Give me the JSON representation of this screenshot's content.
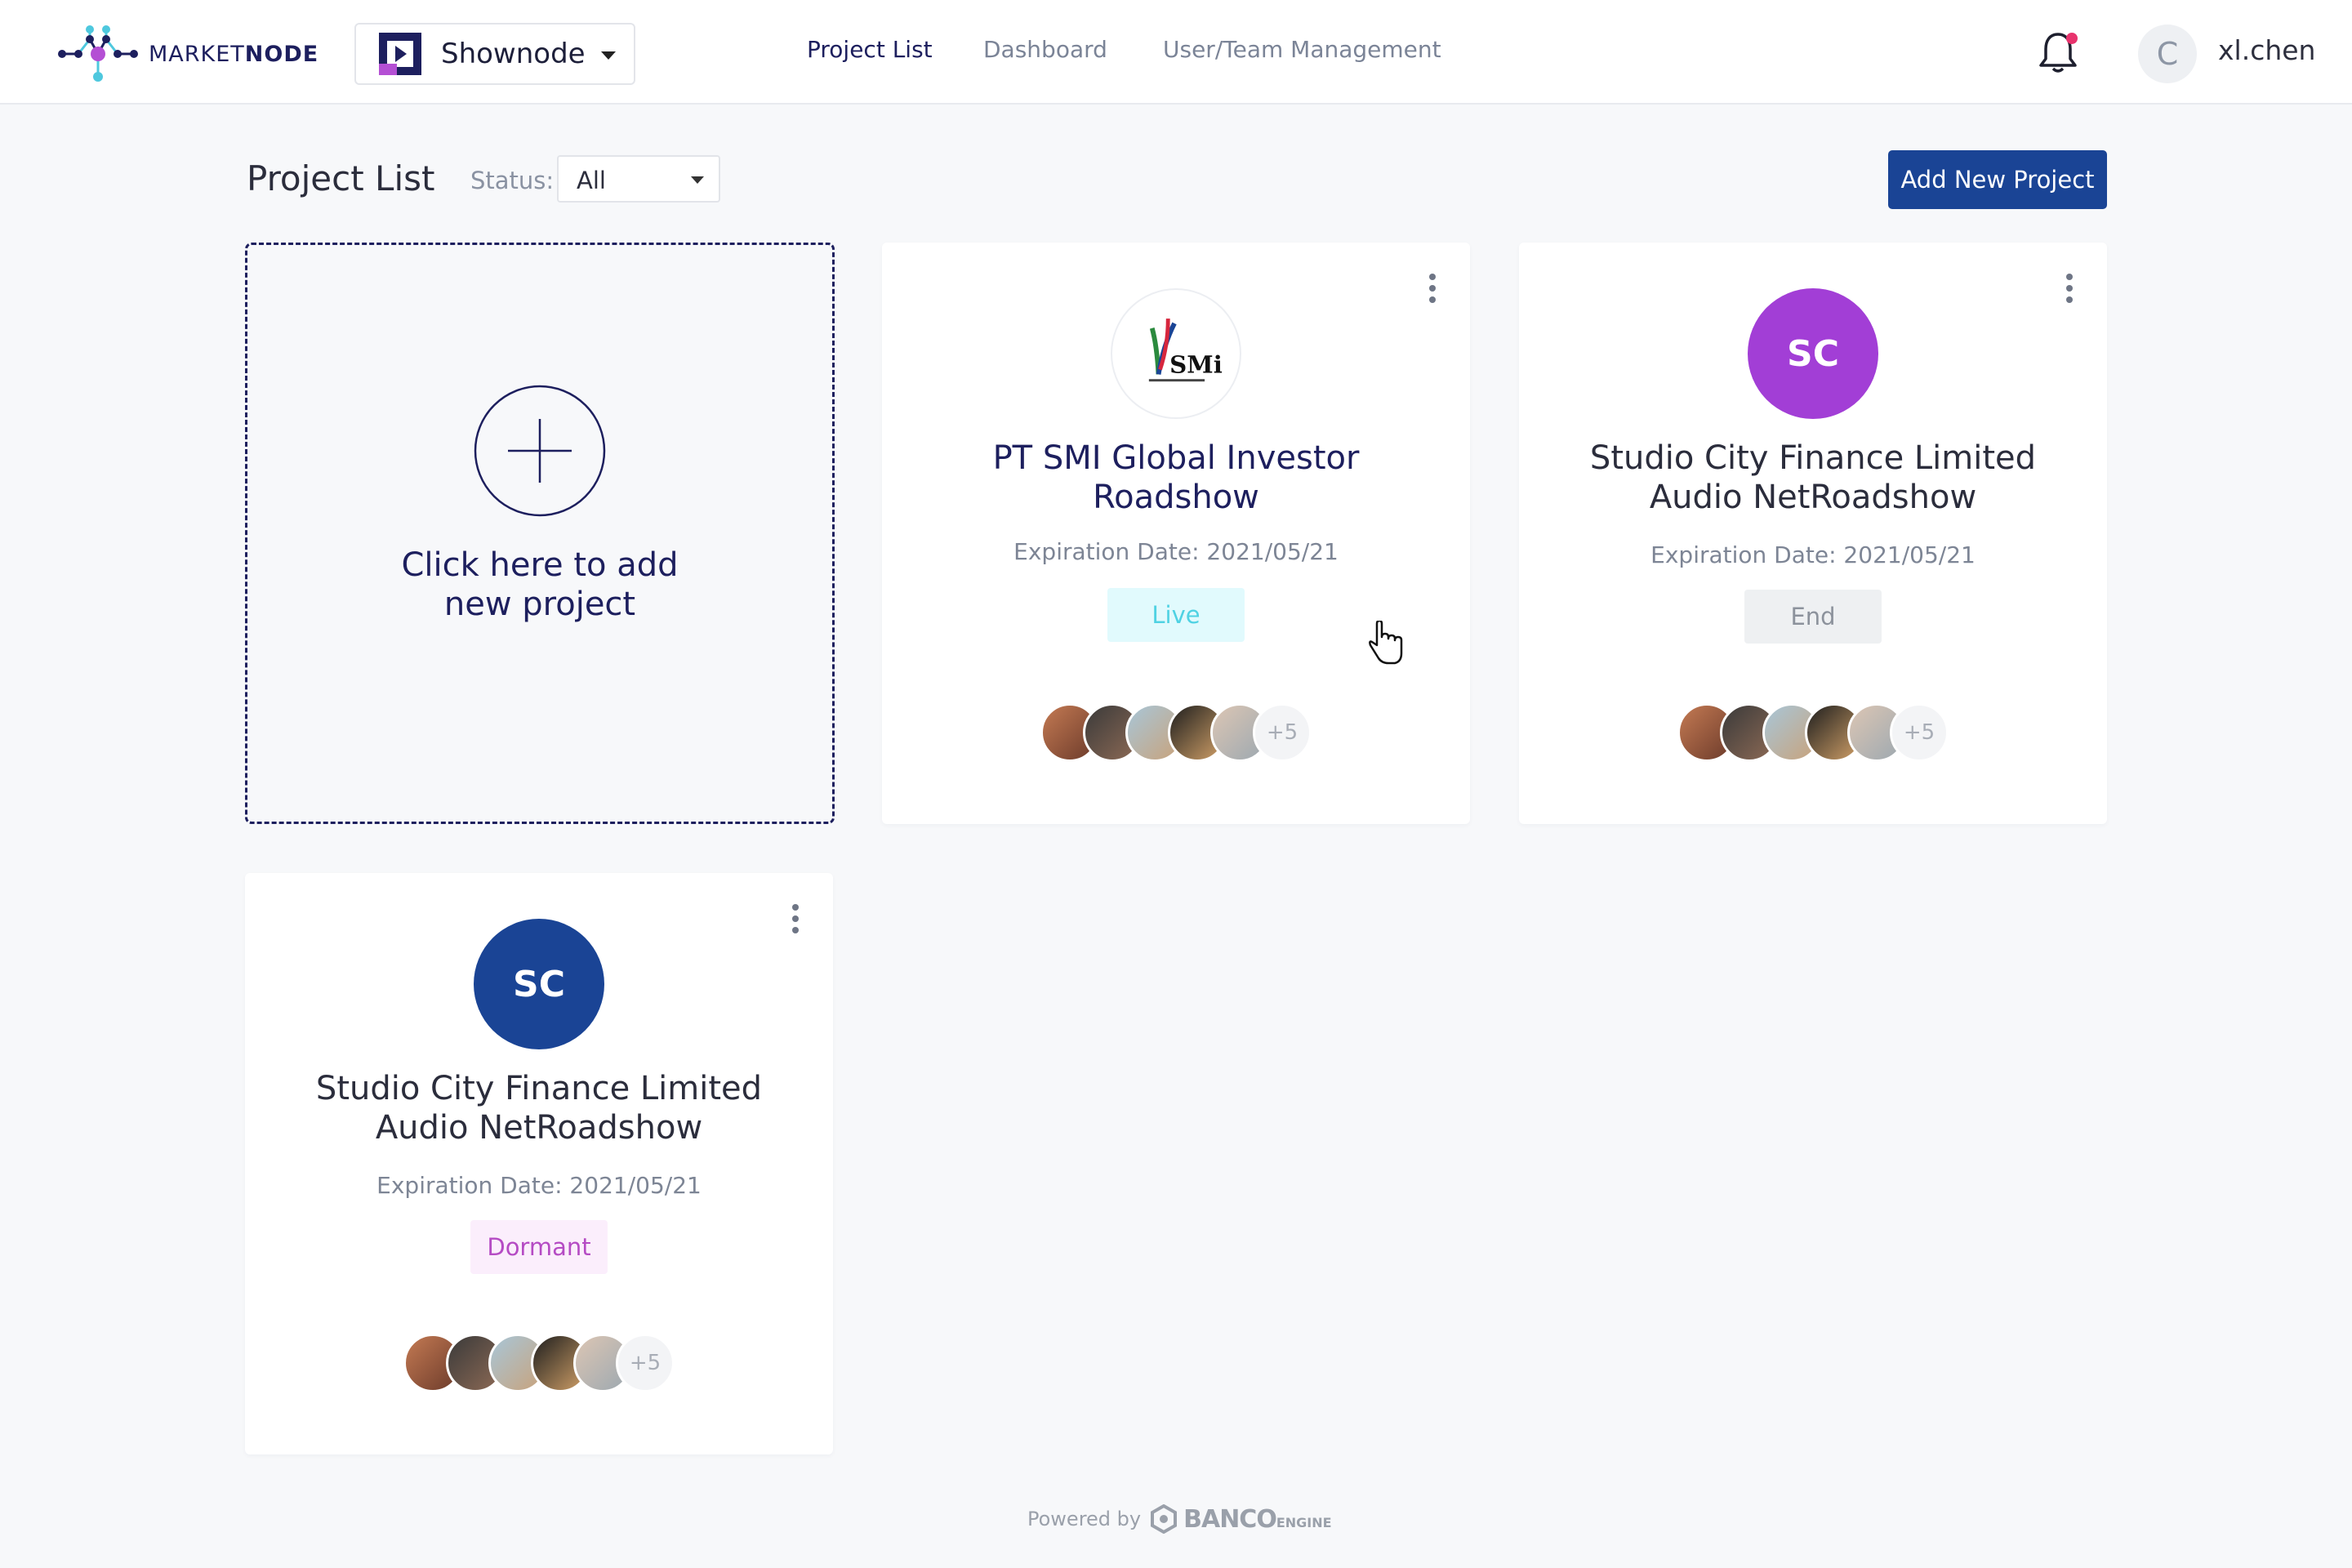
{
  "header": {
    "logo_text_1": "MARKET",
    "logo_text_2": "NODE",
    "app_switcher": {
      "name": "Shownode"
    },
    "nav": [
      {
        "label": "Project List",
        "active": true
      },
      {
        "label": "Dashboard",
        "active": false
      },
      {
        "label": "User/Team Management",
        "active": false
      }
    ],
    "user": {
      "initial": "C",
      "name": "xl.chen"
    },
    "notification_dot": true
  },
  "toolbar": {
    "title": "Project List",
    "status_label": "Status:",
    "status_value": "All",
    "add_button": "Add New Project"
  },
  "add_card": {
    "line1": "Click here to add",
    "line2": "new project"
  },
  "projects": [
    {
      "logo_type": "image",
      "logo_icon": "smi-logo",
      "logo_text": "SMi",
      "title_line1": "PT SMI Global Investor",
      "title_line2": "Roadshow",
      "expiration": "Expiration Date: 2021/05/21",
      "status": "Live",
      "extra_members": "+5"
    },
    {
      "logo_type": "initials",
      "initials": "SC",
      "initials_color": "#a23ed6",
      "title_line1": "Studio City Finance Limited",
      "title_line2": "Audio NetRoadshow",
      "expiration": "Expiration Date: 2021/05/21",
      "status": "End",
      "extra_members": "+5"
    },
    {
      "logo_type": "initials",
      "initials": "SC",
      "initials_color": "#1a4495",
      "title_line1": "Studio City Finance Limited",
      "title_line2": "Audio NetRoadshow",
      "expiration": "Expiration Date: 2021/05/21",
      "status": "Dormant",
      "extra_members": "+5"
    }
  ],
  "footer": {
    "powered_by": "Powered by",
    "brand": "BANCO",
    "brand_suffix": "ENGINE"
  },
  "colors": {
    "primary": "#1a4495",
    "navy": "#1d1f5e",
    "live_bg": "#e1fafd",
    "live_text": "#4fd2e3",
    "end_bg": "#eef0f2",
    "dormant_bg": "#fbeefc",
    "dormant_text": "#b54bc4",
    "notification": "#e8336d"
  }
}
